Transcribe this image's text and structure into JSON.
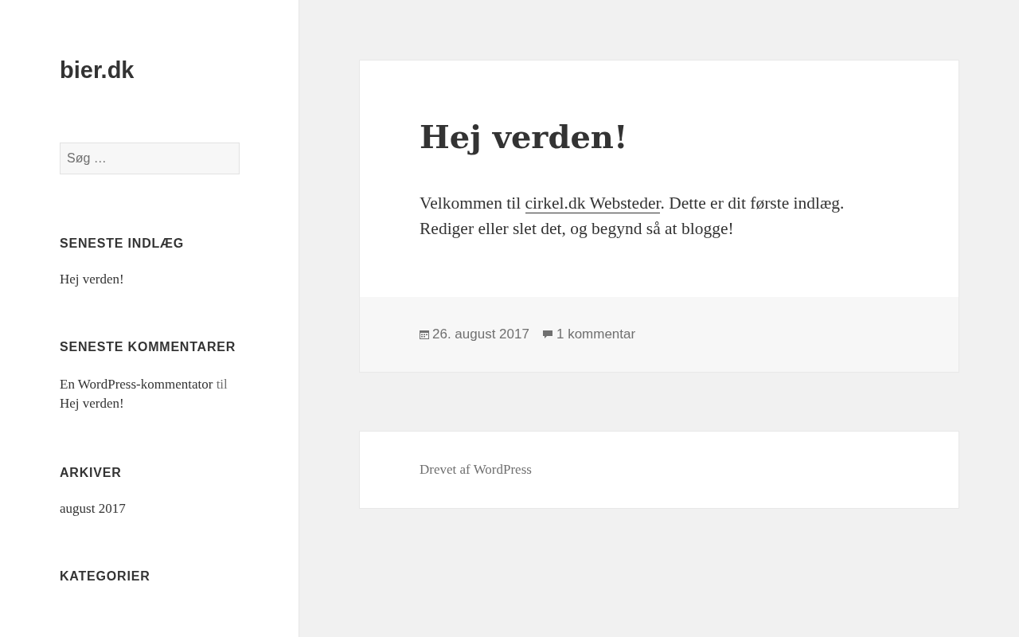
{
  "site": {
    "title": "bier.dk"
  },
  "search": {
    "placeholder": "Søg …"
  },
  "widgets": [
    {
      "kind": "list",
      "title": "SENESTE INDLÆG",
      "items": [
        "Hej verden!"
      ]
    },
    {
      "kind": "comments",
      "title": "SENESTE KOMMENTARER",
      "items": [
        {
          "author": "En WordPress-kommentator",
          "joiner": "til",
          "post": "Hej verden!"
        }
      ]
    },
    {
      "kind": "list",
      "title": "ARKIVER",
      "items": [
        "august 2017"
      ]
    },
    {
      "kind": "list",
      "title": "KATEGORIER"
    }
  ],
  "post": {
    "title": "Hej verden!",
    "content": [
      {
        "kind": "text",
        "text": "Velkommen til "
      },
      {
        "kind": "link",
        "text": "cirkel.dk Websteder"
      },
      {
        "kind": "text",
        "text": ". Dette er dit første indlæg. Rediger eller slet det, og begynd så at blogge!"
      }
    ],
    "date": "26. august 2017",
    "comments": "1 kommentar"
  },
  "footer": {
    "text": "Drevet af WordPress"
  }
}
